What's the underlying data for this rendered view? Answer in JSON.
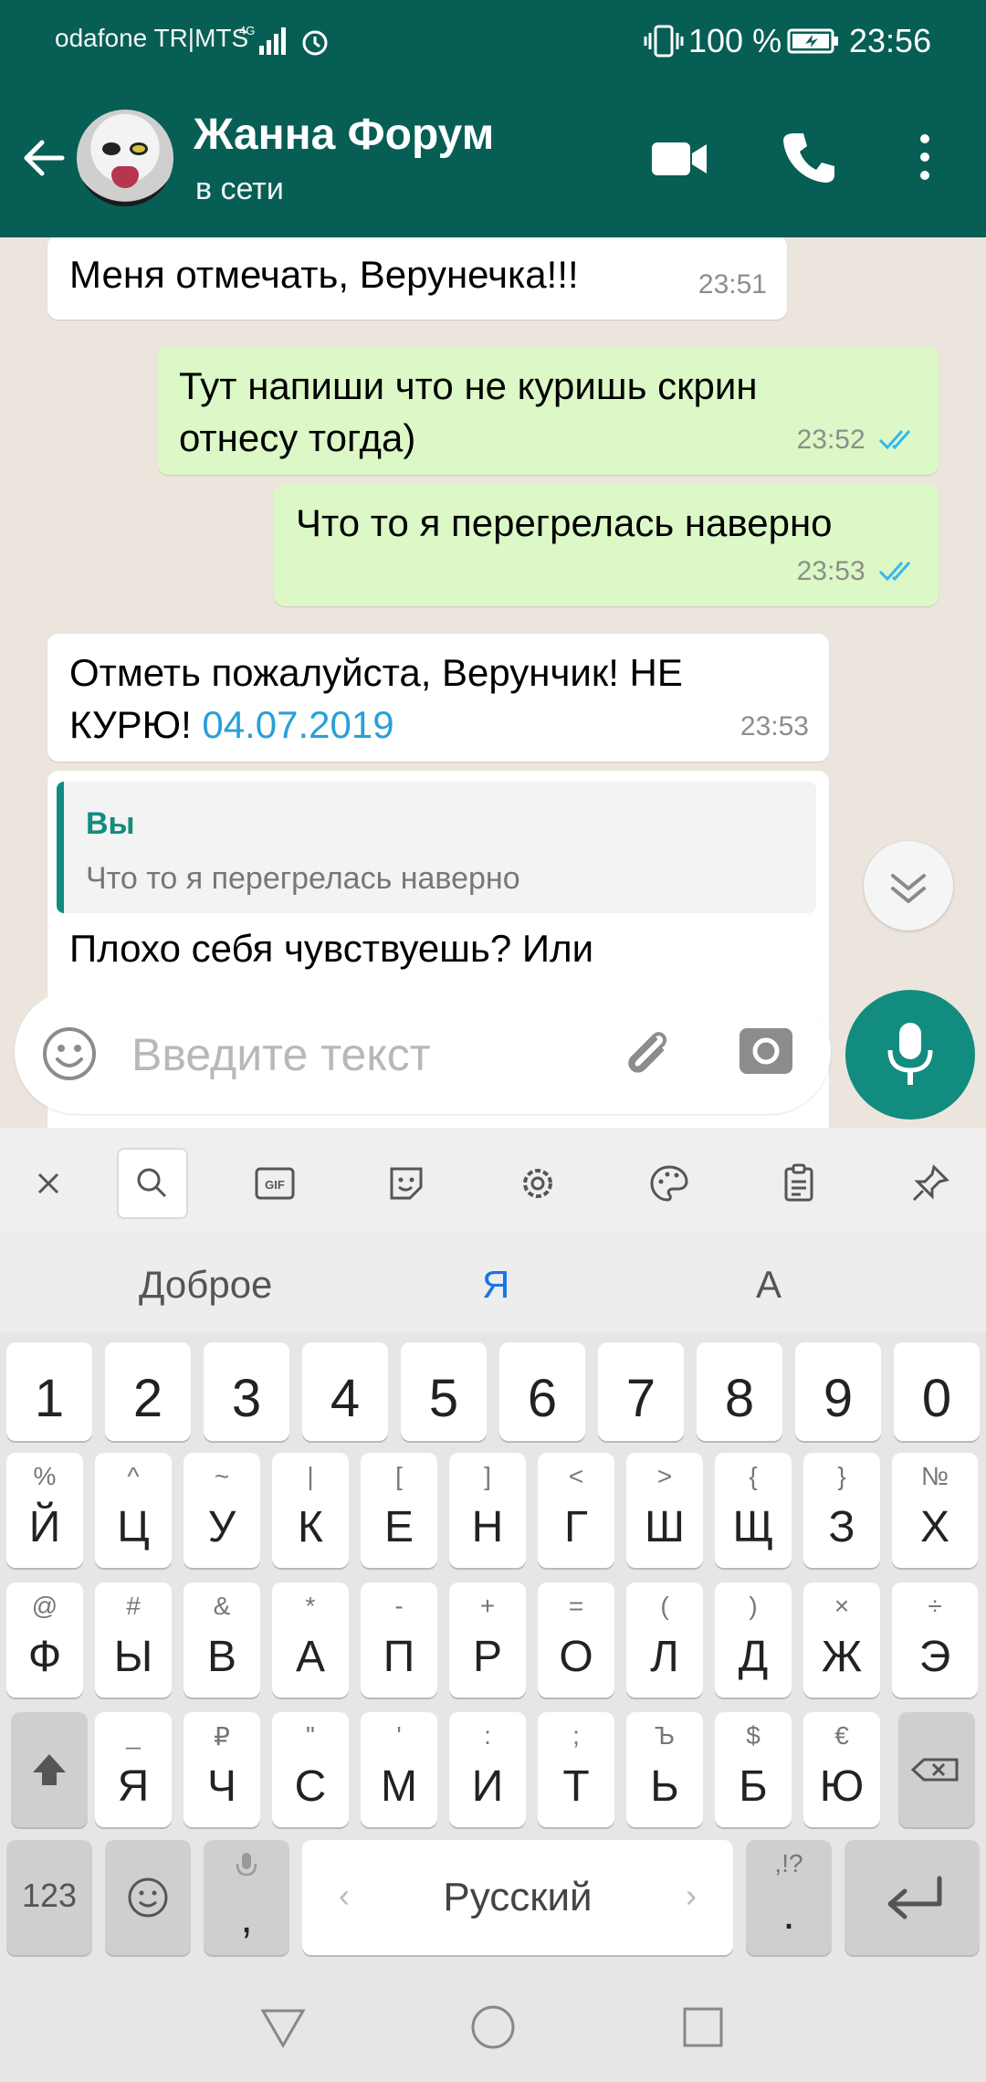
{
  "status_bar": {
    "carrier": "odafone TR|MTS",
    "network": "4G",
    "battery_pct": "100 %",
    "time": "23:56"
  },
  "header": {
    "contact_name": "Жанна Форум",
    "status": "в сети"
  },
  "messages": [
    {
      "dir": "in",
      "text": "Меня отмечать, Верунечка!!!",
      "time": "23:51"
    },
    {
      "dir": "out",
      "line1": "Тут напиши что не куришь скрин",
      "line2": "отнесу тогда)",
      "time": "23:52"
    },
    {
      "dir": "out",
      "text": "Что то я перегрелась наверно",
      "time": "23:53"
    },
    {
      "dir": "in",
      "line1": "Отметь пожалуйста, Верунчик! НЕ",
      "line2": "КУРЮ!",
      "link": "04.07.2019",
      "time": "23:53"
    },
    {
      "dir": "in",
      "quote_author": "Вы",
      "quote_text": "Что то я перегрелась наверно",
      "text": "Плохо себя чувствуешь? Или"
    }
  ],
  "input": {
    "placeholder": "Введите текст"
  },
  "keyboard": {
    "suggestions": [
      "Доброе",
      "Я",
      "А"
    ],
    "number_row": [
      "1",
      "2",
      "3",
      "4",
      "5",
      "6",
      "7",
      "8",
      "9",
      "0"
    ],
    "row1": {
      "main": [
        "Й",
        "Ц",
        "У",
        "К",
        "Е",
        "Н",
        "Г",
        "Ш",
        "Щ",
        "З",
        "Х"
      ],
      "sup": [
        "%",
        "^",
        "~",
        "|",
        "[",
        "]",
        "<",
        ">",
        "{",
        "}",
        "№"
      ]
    },
    "row2": {
      "main": [
        "Ф",
        "Ы",
        "В",
        "А",
        "П",
        "Р",
        "О",
        "Л",
        "Д",
        "Ж",
        "Э"
      ],
      "sup": [
        "@",
        "#",
        "&",
        "*",
        "-",
        "+",
        "=",
        "(",
        ")",
        "×",
        "÷"
      ]
    },
    "row3": {
      "main": [
        "Я",
        "Ч",
        "С",
        "М",
        "И",
        "Т",
        "Ь",
        "Б",
        "Ю"
      ],
      "sup": [
        "_",
        "₽",
        "\"",
        "'",
        ":",
        ";",
        "Ъ",
        "$",
        "€"
      ]
    },
    "bottom": {
      "numbers_key": "123",
      "comma_key": ",",
      "space_label": "Русский",
      "period_key": ".",
      "period_sup": ",!?"
    }
  },
  "colors": {
    "header_bg": "#075e54",
    "accent": "#128c7e",
    "outgoing_bubble": "#dcf8c6",
    "read_tick": "#34b7f1"
  }
}
